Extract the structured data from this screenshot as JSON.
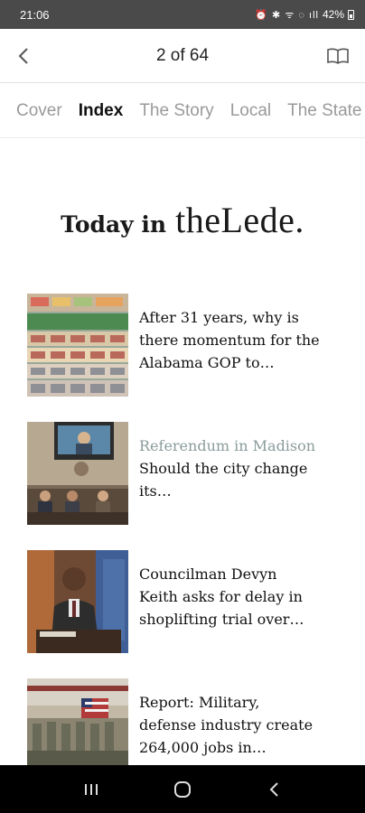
{
  "status_bar": {
    "time": "21:06",
    "icons": "⏰ ✱ ᯤ ◌ ıll",
    "battery": "42%"
  },
  "header": {
    "page_counter": "2 of 64"
  },
  "tabs": [
    {
      "label": "Cover"
    },
    {
      "label": "Index"
    },
    {
      "label": "The Story"
    },
    {
      "label": "Local"
    },
    {
      "label": "The State"
    }
  ],
  "masthead": {
    "prefix": "Today in",
    "brand": "theLede."
  },
  "stories": [
    {
      "kicker": "",
      "headline": "After 31 years, why is there momentum for the Alabama GOP to…"
    },
    {
      "kicker": "Referendum in Madison",
      "headline": "Should the city change its…"
    },
    {
      "kicker": "",
      "headline": "Councilman Devyn Keith asks for delay in shoplifting trial over…"
    },
    {
      "kicker": "",
      "headline": "Report: Military, defense industry create 264,000 jobs in…"
    }
  ],
  "colors": {
    "status_bar": "#4a4a4a",
    "active_tab": "#111111",
    "inactive_tab": "#9a9a9a",
    "kicker": "#8a9b9b"
  }
}
